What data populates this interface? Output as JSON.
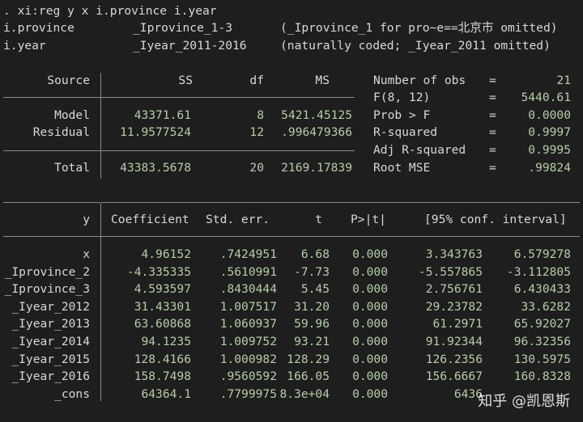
{
  "command": ". xi:reg y x i.province i.year",
  "xi_lines": [
    {
      "var": "i.province",
      "dummy": "_Iprovince_1-3",
      "note": "(_Iprovince_1 for pro~e==北京市 omitted)"
    },
    {
      "var": "i.year",
      "dummy": "_Iyear_2011-2016",
      "note": "(naturally coded; _Iyear_2011 omitted)"
    }
  ],
  "anova": {
    "headers": {
      "source": "Source",
      "ss": "SS",
      "df": "df",
      "ms": "MS"
    },
    "rows": [
      {
        "source": "Model",
        "ss": "43371.61",
        "df": "8",
        "ms": "5421.45125"
      },
      {
        "source": "Residual",
        "ss": "11.9577524",
        "df": "12",
        "ms": ".996479366"
      }
    ],
    "total": {
      "source": "Total",
      "ss": "43383.5678",
      "df": "20",
      "ms": "2169.17839"
    }
  },
  "stats": [
    {
      "label": "Number of obs",
      "eq": "=",
      "value": "21"
    },
    {
      "label": "F(8, 12)",
      "eq": "=",
      "value": "5440.61"
    },
    {
      "label": "Prob > F",
      "eq": "=",
      "value": "0.0000"
    },
    {
      "label": "R-squared",
      "eq": "=",
      "value": "0.9997"
    },
    {
      "label": "Adj R-squared",
      "eq": "=",
      "value": "0.9995"
    },
    {
      "label": "Root MSE",
      "eq": "=",
      "value": ".99824"
    }
  ],
  "coef_table": {
    "headers": {
      "y": "y",
      "coef": "Coefficient",
      "se": "Std. err.",
      "t": "t",
      "p": "P>|t|",
      "ci": "[95% conf. interval]"
    },
    "rows": [
      {
        "var": "x",
        "coef": "4.96152",
        "se": ".7424951",
        "t": "6.68",
        "p": "0.000",
        "lo": "3.343763",
        "hi": "6.579278"
      },
      {
        "var": "_Iprovince_2",
        "coef": "-4.335335",
        "se": ".5610991",
        "t": "-7.73",
        "p": "0.000",
        "lo": "-5.557865",
        "hi": "-3.112805"
      },
      {
        "var": "_Iprovince_3",
        "coef": "4.593597",
        "se": ".8430444",
        "t": "5.45",
        "p": "0.000",
        "lo": "2.756761",
        "hi": "6.430433"
      },
      {
        "var": "_Iyear_2012",
        "coef": "31.43301",
        "se": "1.007517",
        "t": "31.20",
        "p": "0.000",
        "lo": "29.23782",
        "hi": "33.6282"
      },
      {
        "var": "_Iyear_2013",
        "coef": "63.60868",
        "se": "1.060937",
        "t": "59.96",
        "p": "0.000",
        "lo": "61.2971",
        "hi": "65.92027"
      },
      {
        "var": "_Iyear_2014",
        "coef": "94.1235",
        "se": "1.009752",
        "t": "93.21",
        "p": "0.000",
        "lo": "91.92344",
        "hi": "96.32356"
      },
      {
        "var": "_Iyear_2015",
        "coef": "128.4166",
        "se": "1.000982",
        "t": "128.29",
        "p": "0.000",
        "lo": "126.2356",
        "hi": "130.5975"
      },
      {
        "var": "_Iyear_2016",
        "coef": "158.7498",
        "se": ".9560592",
        "t": "166.05",
        "p": "0.000",
        "lo": "156.6667",
        "hi": "160.8328"
      },
      {
        "var": "_cons",
        "coef": "64364.1",
        "se": ".7799975",
        "t": "8.3e+04",
        "p": "0.000",
        "lo": "6436",
        "hi": ""
      }
    ]
  },
  "watermark": "知乎 @凯恩斯",
  "colors": {
    "background": "#1e1e1e",
    "text": "#d8d8d8",
    "values": "#b5cea8",
    "rule": "#8a8a8a"
  }
}
